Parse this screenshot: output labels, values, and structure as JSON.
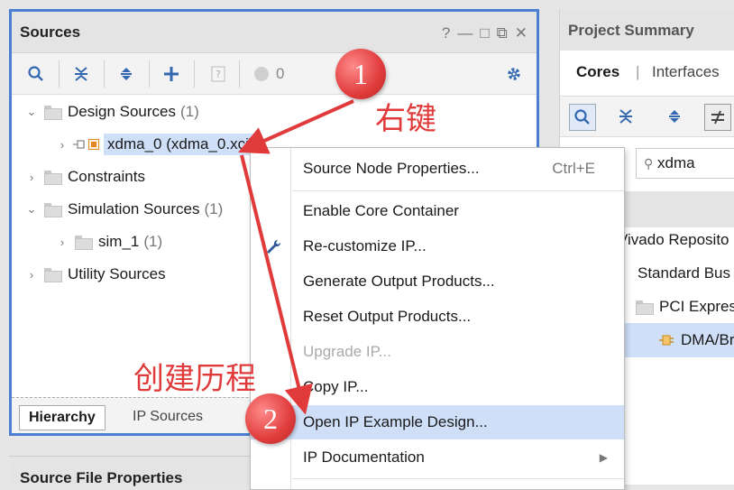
{
  "sources_panel": {
    "title": "Sources",
    "window_controls": [
      "?",
      "—",
      "□",
      "⧉",
      "✕"
    ],
    "toolbar": {
      "status_count": "0"
    },
    "tree": [
      {
        "label": "Design Sources",
        "count": "(1)",
        "expanded": true
      },
      {
        "label": "xdma_0 (xdma_0.xci)",
        "count": "",
        "selected": true
      },
      {
        "label": "Constraints",
        "count": "",
        "expanded": false
      },
      {
        "label": "Simulation Sources",
        "count": "(1)",
        "expanded": true
      },
      {
        "label": "sim_1",
        "count": "(1)",
        "expanded": false
      },
      {
        "label": "Utility Sources",
        "count": "",
        "expanded": false
      }
    ],
    "tabs": {
      "active": "Hierarchy",
      "inactive": "IP Sources"
    }
  },
  "source_file_properties": {
    "title": "Source File Properties"
  },
  "project_summary": {
    "title": "Project Summary",
    "tabs": [
      "Cores",
      "|",
      "Interfaces"
    ],
    "search_value": "xdma",
    "tree": [
      "Vivado Reposito",
      "Standard Bus",
      "PCI Expres",
      "DMA/Br"
    ]
  },
  "context_menu": {
    "items": [
      {
        "label": "Source Node Properties...",
        "shortcut": "Ctrl+E"
      },
      {
        "label": "Enable Core Container"
      },
      {
        "label": "Re-customize IP...",
        "icon": "wrench-icon"
      },
      {
        "label": "Generate Output Products..."
      },
      {
        "label": "Reset Output Products..."
      },
      {
        "label": "Upgrade IP...",
        "disabled": true
      },
      {
        "label": "Copy IP..."
      },
      {
        "label": "Open IP Example Design...",
        "highlighted": true
      },
      {
        "label": "IP Documentation",
        "submenu": true
      }
    ]
  },
  "annotations": {
    "step1_number": "1",
    "step1_text": "右键",
    "step2_number": "2",
    "step2_text": "创建历程",
    "color": "#e03a3a"
  }
}
